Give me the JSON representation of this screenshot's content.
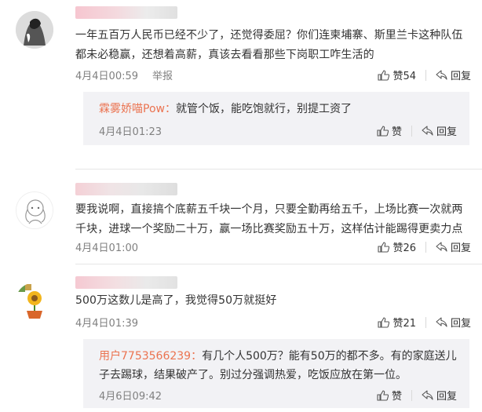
{
  "comments": [
    {
      "text": "一年五百万人民币已经不少了，还觉得委屈？你们连柬埔寨、斯里兰卡这种队伍都未必稳赢，还想着高薪，真该去看看那些下岗职工咋生活的",
      "time": "4月4日00:59",
      "report_label": "举报",
      "like_label": "赞54",
      "reply_label": "回复",
      "reply": {
        "user": "霖雾娇喵Pow：",
        "text": "就管个饭，能吃饱就行，别提工资了",
        "time": "4月4日01:23",
        "like_label": "赞",
        "reply_label": "回复"
      }
    },
    {
      "text": "要我说啊，直接搞个底薪五千块一个月，只要全勤再给五千，上场比赛一次就两千块，进球一个奖励二十万，赢一场比赛奖励五十万，这样估计能踢得更卖力点",
      "time": "4月4日01:00",
      "like_label": "赞26",
      "reply_label": "回复"
    },
    {
      "text": "500万这数儿是高了，我觉得50万就挺好",
      "time": "4月4日01:39",
      "like_label": "赞21",
      "reply_label": "回复",
      "reply": {
        "user": "用户7753566239：",
        "text": "有几个人500万？能有50万的都不多。有的家庭送儿子去踢球，结果破产了。别过分强调热爱，吃饭应放在第一位。",
        "time": "4月6日09:42",
        "like_label": "赞",
        "reply_label": "回复"
      }
    }
  ],
  "colors": {
    "username": "#eb7350",
    "meta": "#808080",
    "reply_bg": "#f2f2f5"
  }
}
